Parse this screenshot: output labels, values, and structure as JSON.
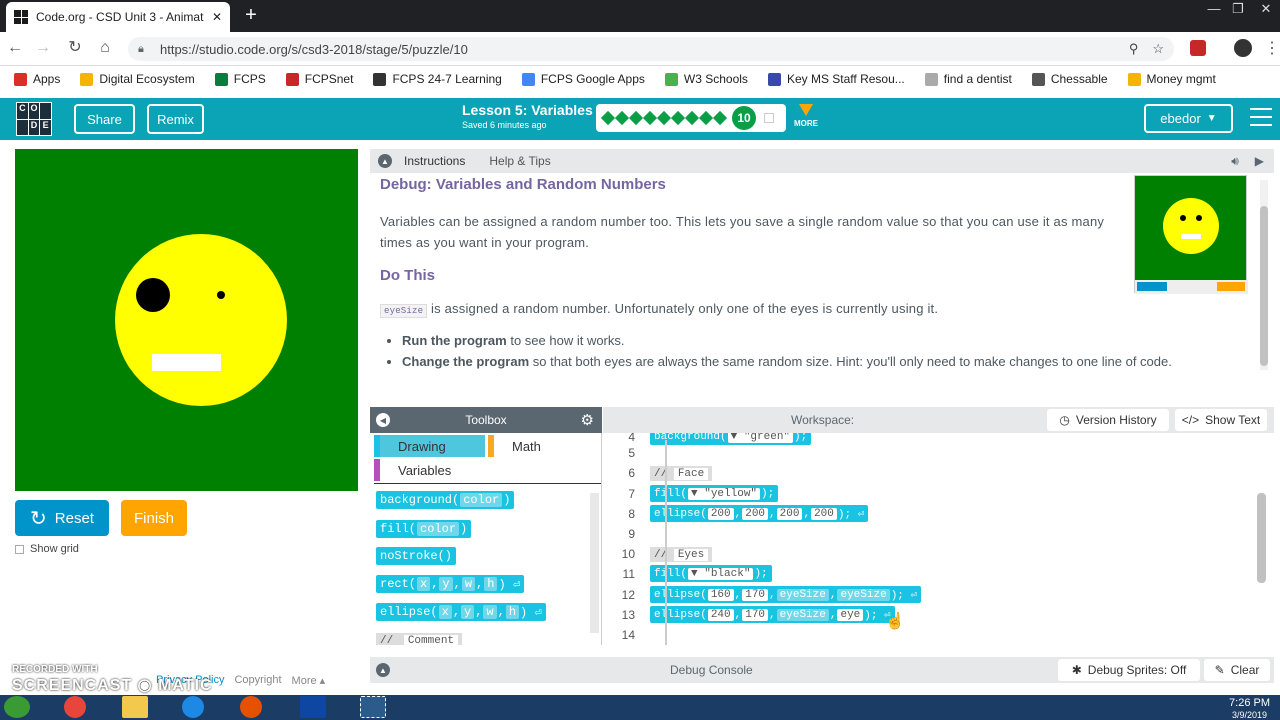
{
  "browser": {
    "tab_title": "Code.org - CSD Unit 3 - Animatio",
    "new_tab": "+",
    "url": "https://studio.code.org/s/csd3-2018/stage/5/puzzle/10",
    "bookmarks": [
      {
        "label": "Apps",
        "color": "#d93025"
      },
      {
        "label": "Digital Ecosystem",
        "color": "#f4b400"
      },
      {
        "label": "FCPS",
        "color": "#0a7d3e"
      },
      {
        "label": "FCPSnet",
        "color": "#c62828"
      },
      {
        "label": "FCPS 24-7 Learning",
        "color": "#333333"
      },
      {
        "label": "FCPS Google Apps",
        "color": "#4285f4"
      },
      {
        "label": "W3 Schools",
        "color": "#4caf50"
      },
      {
        "label": "Key MS Staff Resou...",
        "color": "#3949ab"
      },
      {
        "label": "find a dentist",
        "color": "#aaaaaa"
      },
      {
        "label": "Chessable",
        "color": "#555555"
      },
      {
        "label": "Money mgmt",
        "color": "#f4b400"
      }
    ]
  },
  "header": {
    "share_label": "Share",
    "remix_label": "Remix",
    "lesson_title": "Lesson 5: Variables",
    "saved_text": "Saved 6 minutes ago",
    "progress_current": "10",
    "more_label": "MORE",
    "user_label": "ebedor"
  },
  "stage": {
    "reset_label": "Reset",
    "finish_label": "Finish",
    "show_grid_label": "Show grid",
    "footer": {
      "privacy": "Privacy Policy",
      "copyright": "Copyright",
      "more": "More ▴"
    }
  },
  "watermark": {
    "line1": "RECORDED WITH",
    "line2": "SCREENCAST ◉ MATIC"
  },
  "instructions": {
    "tab_instructions": "Instructions",
    "tab_help": "Help & Tips",
    "title": "Debug: Variables and Random Numbers",
    "paragraph": "Variables can be assigned a random number too. This lets you save a single random value so that you can use it as many times as you want in your program.",
    "do_this": "Do This",
    "code_var": "eyeSize",
    "do_text": " is assigned a random number. Unfortunately only one of the eyes is currently using it.",
    "bullets": [
      {
        "bold": "Run the program",
        "rest": " to see how it works."
      },
      {
        "bold": "Change the program",
        "rest": " so that both eyes are always the same random size. Hint: you'll only need to make changes to one line of code."
      }
    ]
  },
  "toolbox": {
    "title": "Toolbox",
    "categories": [
      "Drawing",
      "Math",
      "Variables"
    ],
    "blocks": [
      {
        "name": "background",
        "args": [
          "color"
        ]
      },
      {
        "name": "fill",
        "args": [
          "color"
        ]
      },
      {
        "name": "noStroke",
        "args": []
      },
      {
        "name": "rect",
        "args": [
          "x",
          "y",
          "w",
          "h"
        ]
      },
      {
        "name": "ellipse",
        "args": [
          "x",
          "y",
          "w",
          "h"
        ]
      }
    ],
    "comment_label": "Comment"
  },
  "workspace": {
    "title": "Workspace:",
    "version_history": "Version History",
    "show_text": "Show Text",
    "lines": [
      {
        "n": "4",
        "code": "background(\"green\");"
      },
      {
        "n": "5",
        "code": ""
      },
      {
        "n": "6",
        "code": "// Face"
      },
      {
        "n": "7",
        "code": "fill(\"yellow\");"
      },
      {
        "n": "8",
        "code": "ellipse(200, 200, 200, 200);"
      },
      {
        "n": "9",
        "code": ""
      },
      {
        "n": "10",
        "code": "// Eyes"
      },
      {
        "n": "11",
        "code": "fill(\"black\");"
      },
      {
        "n": "12",
        "code": "ellipse(160, 170, eyeSize, eyeSize);"
      },
      {
        "n": "13",
        "code": "ellipse(240, 170, eyeSize, eye);"
      },
      {
        "n": "14",
        "code": ""
      }
    ]
  },
  "debug": {
    "title": "Debug Console",
    "sprites": "Debug Sprites: Off",
    "clear": "Clear"
  },
  "taskbar": {
    "time": "7:26 PM",
    "date": "3/9/2019"
  }
}
